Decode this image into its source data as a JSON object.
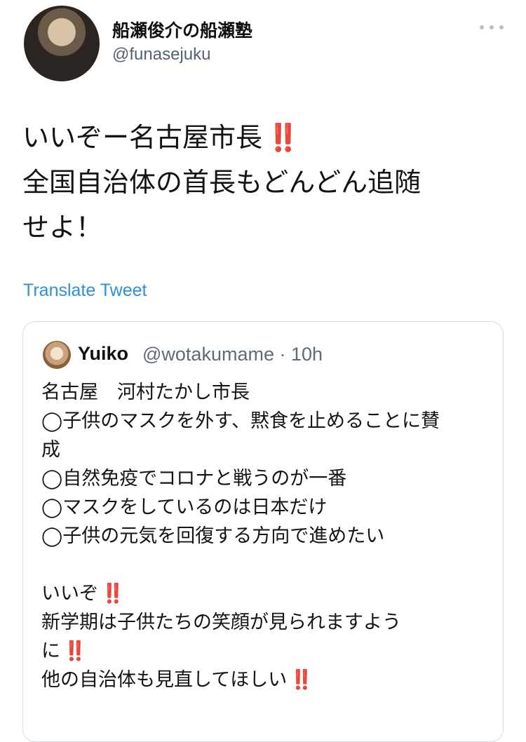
{
  "author": {
    "display_name": "船瀬俊介の船瀬塾",
    "handle": "@funasejuku"
  },
  "more_icon": "more-horizontal-icon",
  "tweet": {
    "lines": [
      "いいぞー名古屋市長",
      "全国自治体の首長もどんどん追随",
      "せよ！"
    ],
    "emphasis": "‼️"
  },
  "translate_label": "Translate Tweet",
  "quoted": {
    "name": "Yuiko",
    "handle_time": "@wotakumame · 10h",
    "lines": [
      "名古屋　河村たかし市長",
      "◯子供のマスクを外す、黙食を止めることに賛",
      "成",
      "◯自然免疫でコロナと戦うのが一番",
      "◯マスクをしているのは日本だけ",
      "◯子供の元気を回復する方向で進めたい",
      "",
      "いいぞ",
      "新学期は子供たちの笑顔が見られますよう",
      "に",
      "他の自治体も見直してほしい"
    ],
    "emphasis": "‼️"
  },
  "colors": {
    "link": "#2f8fd8",
    "emphasis_red": "#e0242b",
    "secondary_text": "#556370",
    "card_border": "#d6dde3"
  }
}
